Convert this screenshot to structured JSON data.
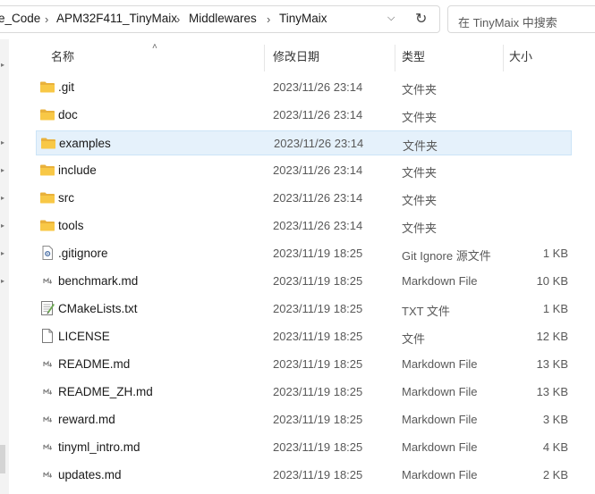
{
  "breadcrumb": [
    {
      "label": "e_Code"
    },
    {
      "label": "APM32F411_TinyMaix"
    },
    {
      "label": "Middlewares"
    },
    {
      "label": "TinyMaix"
    }
  ],
  "search": {
    "placeholder": "在 TinyMaix 中搜索"
  },
  "columns": {
    "name": "名称",
    "date": "修改日期",
    "type": "类型",
    "size": "大小"
  },
  "files": [
    {
      "name": ".git",
      "date": "2023/11/26 23:14",
      "type": "文件夹",
      "size": "",
      "icon": "folder-icon"
    },
    {
      "name": "doc",
      "date": "2023/11/26 23:14",
      "type": "文件夹",
      "size": "",
      "icon": "folder-icon"
    },
    {
      "name": "examples",
      "date": "2023/11/26 23:14",
      "type": "文件夹",
      "size": "",
      "icon": "folder-icon",
      "selected": true
    },
    {
      "name": "include",
      "date": "2023/11/26 23:14",
      "type": "文件夹",
      "size": "",
      "icon": "folder-icon"
    },
    {
      "name": "src",
      "date": "2023/11/26 23:14",
      "type": "文件夹",
      "size": "",
      "icon": "folder-icon"
    },
    {
      "name": "tools",
      "date": "2023/11/26 23:14",
      "type": "文件夹",
      "size": "",
      "icon": "folder-icon"
    },
    {
      "name": ".gitignore",
      "date": "2023/11/19 18:25",
      "type": "Git Ignore 源文件",
      "size": "1 KB",
      "icon": "config-file-icon"
    },
    {
      "name": "benchmark.md",
      "date": "2023/11/19 18:25",
      "type": "Markdown File",
      "size": "10 KB",
      "icon": "markdown-file-icon"
    },
    {
      "name": "CMakeLists.txt",
      "date": "2023/11/19 18:25",
      "type": "TXT 文件",
      "size": "1 KB",
      "icon": "text-file-icon"
    },
    {
      "name": "LICENSE",
      "date": "2023/11/19 18:25",
      "type": "文件",
      "size": "12 KB",
      "icon": "blank-file-icon"
    },
    {
      "name": "README.md",
      "date": "2023/11/19 18:25",
      "type": "Markdown File",
      "size": "13 KB",
      "icon": "markdown-file-icon"
    },
    {
      "name": "README_ZH.md",
      "date": "2023/11/19 18:25",
      "type": "Markdown File",
      "size": "13 KB",
      "icon": "markdown-file-icon"
    },
    {
      "name": "reward.md",
      "date": "2023/11/19 18:25",
      "type": "Markdown File",
      "size": "3 KB",
      "icon": "markdown-file-icon"
    },
    {
      "name": "tinyml_intro.md",
      "date": "2023/11/19 18:25",
      "type": "Markdown File",
      "size": "4 KB",
      "icon": "markdown-file-icon"
    },
    {
      "name": "updates.md",
      "date": "2023/11/19 18:25",
      "type": "Markdown File",
      "size": "2 KB",
      "icon": "markdown-file-icon"
    }
  ],
  "colors": {
    "selection": "#e5f1fb",
    "folder": "#f8c846"
  }
}
